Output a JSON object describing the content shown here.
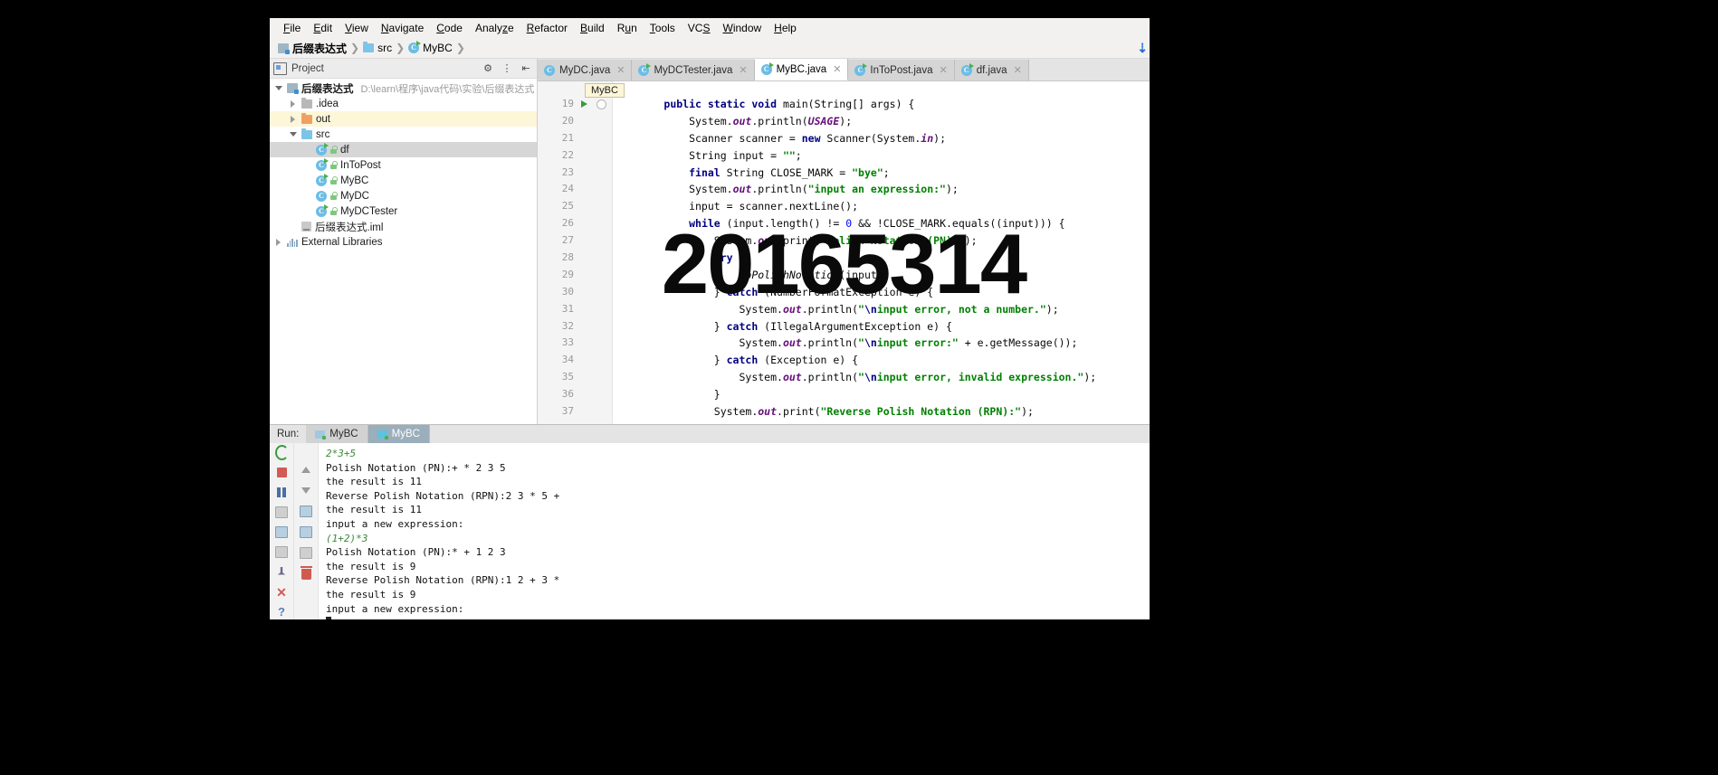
{
  "window": {
    "app": "IntelliJ IDEA",
    "watermark": "20165314"
  },
  "menubar": {
    "items": [
      {
        "label": "File",
        "mnemonic": "F"
      },
      {
        "label": "Edit",
        "mnemonic": "E"
      },
      {
        "label": "View",
        "mnemonic": "V"
      },
      {
        "label": "Navigate",
        "mnemonic": "N"
      },
      {
        "label": "Code",
        "mnemonic": "C"
      },
      {
        "label": "Analyze",
        "mnemonic": "z"
      },
      {
        "label": "Refactor",
        "mnemonic": "R"
      },
      {
        "label": "Build",
        "mnemonic": "B"
      },
      {
        "label": "Run",
        "mnemonic": "u"
      },
      {
        "label": "Tools",
        "mnemonic": "T"
      },
      {
        "label": "VCS",
        "mnemonic": "S"
      },
      {
        "label": "Window",
        "mnemonic": "W"
      },
      {
        "label": "Help",
        "mnemonic": "H"
      }
    ]
  },
  "breadcrumb": {
    "items": [
      "后缀表达式",
      "src",
      "MyBC"
    ],
    "download_icon": "download-icon"
  },
  "project_pane": {
    "title": "Project",
    "tree": [
      {
        "label": "后缀表达式",
        "path": "D:\\learn\\程序\\java代码\\实验\\后缀表达式",
        "indent": 0,
        "icon": "module-icon",
        "state": "open",
        "bold": true
      },
      {
        "label": ".idea",
        "path": "",
        "indent": 1,
        "icon": "folder-gray-icon",
        "state": "closed",
        "bold": false
      },
      {
        "label": "out",
        "path": "",
        "indent": 1,
        "icon": "folder-orange-icon",
        "state": "closed",
        "bold": false,
        "highlight": true
      },
      {
        "label": "src",
        "path": "",
        "indent": 1,
        "icon": "folder-blue-icon",
        "state": "open",
        "bold": false
      },
      {
        "label": "df",
        "path": "",
        "indent": 2,
        "icon": "java-class-runnable-icon",
        "state": "leaf",
        "bold": false,
        "selected": true
      },
      {
        "label": "InToPost",
        "path": "",
        "indent": 2,
        "icon": "java-class-runnable-icon",
        "state": "leaf",
        "bold": false
      },
      {
        "label": "MyBC",
        "path": "",
        "indent": 2,
        "icon": "java-class-runnable-icon",
        "state": "leaf",
        "bold": false
      },
      {
        "label": "MyDC",
        "path": "",
        "indent": 2,
        "icon": "java-class-icon",
        "state": "leaf",
        "bold": false
      },
      {
        "label": "MyDCTester",
        "path": "",
        "indent": 2,
        "icon": "java-class-runnable-icon",
        "state": "leaf",
        "bold": false
      },
      {
        "label": "后缀表达式.iml",
        "path": "",
        "indent": 1,
        "icon": "iml-file-icon",
        "state": "leaf",
        "bold": false
      },
      {
        "label": "External Libraries",
        "path": "",
        "indent": 0,
        "icon": "library-icon",
        "state": "closed",
        "bold": false
      }
    ]
  },
  "editor": {
    "tabs": [
      {
        "label": "MyDC.java",
        "active": false,
        "icon": "java-class-icon"
      },
      {
        "label": "MyDCTester.java",
        "active": false,
        "icon": "java-class-runnable-icon"
      },
      {
        "label": "MyBC.java",
        "active": true,
        "icon": "java-class-runnable-icon"
      },
      {
        "label": "InToPost.java",
        "active": false,
        "icon": "java-class-runnable-icon"
      },
      {
        "label": "df.java",
        "active": false,
        "icon": "java-class-runnable-icon"
      }
    ],
    "breadcrumb_tooltip": "MyBC",
    "lines": [
      {
        "num": "19",
        "gutter": "run-arrow",
        "tokens": [
          {
            "t": "        ",
            "c": "p"
          },
          {
            "t": "public static void ",
            "c": "kw"
          },
          {
            "t": "main(String[] args) {",
            "c": "p"
          }
        ]
      },
      {
        "num": "20",
        "gutter": "",
        "tokens": [
          {
            "t": "            System.",
            "c": "p"
          },
          {
            "t": "out",
            "c": "fld"
          },
          {
            "t": ".println(",
            "c": "p"
          },
          {
            "t": "USAGE",
            "c": "stat"
          },
          {
            "t": ");",
            "c": "p"
          }
        ]
      },
      {
        "num": "21",
        "gutter": "",
        "tokens": [
          {
            "t": "            Scanner scanner = ",
            "c": "p"
          },
          {
            "t": "new",
            "c": "kw"
          },
          {
            "t": " Scanner(System.",
            "c": "p"
          },
          {
            "t": "in",
            "c": "fld"
          },
          {
            "t": ");",
            "c": "p"
          }
        ]
      },
      {
        "num": "22",
        "gutter": "",
        "tokens": [
          {
            "t": "            String input = ",
            "c": "p"
          },
          {
            "t": "\"\"",
            "c": "str"
          },
          {
            "t": ";",
            "c": "p"
          }
        ]
      },
      {
        "num": "23",
        "gutter": "",
        "tokens": [
          {
            "t": "            ",
            "c": "p"
          },
          {
            "t": "final",
            "c": "kw"
          },
          {
            "t": " String CLOSE_MARK = ",
            "c": "p"
          },
          {
            "t": "\"bye\"",
            "c": "str"
          },
          {
            "t": ";",
            "c": "p"
          }
        ]
      },
      {
        "num": "24",
        "gutter": "",
        "tokens": [
          {
            "t": "            System.",
            "c": "p"
          },
          {
            "t": "out",
            "c": "fld"
          },
          {
            "t": ".println(",
            "c": "p"
          },
          {
            "t": "\"input an expression:\"",
            "c": "str"
          },
          {
            "t": ");",
            "c": "p"
          }
        ]
      },
      {
        "num": "25",
        "gutter": "",
        "tokens": [
          {
            "t": "            input = scanner.nextLine();",
            "c": "p"
          }
        ]
      },
      {
        "num": "26",
        "gutter": "",
        "tokens": [
          {
            "t": "            ",
            "c": "p"
          },
          {
            "t": "while",
            "c": "kw"
          },
          {
            "t": " (input.length() != ",
            "c": "p"
          },
          {
            "t": "0",
            "c": "num"
          },
          {
            "t": " && !CLOSE_MARK.equals((input))) {",
            "c": "p"
          }
        ]
      },
      {
        "num": "27",
        "gutter": "",
        "tokens": [
          {
            "t": "                System.",
            "c": "p"
          },
          {
            "t": "out",
            "c": "fld"
          },
          {
            "t": ".print(",
            "c": "p"
          },
          {
            "t": "\"Polish Notation (PN):\"",
            "c": "str"
          },
          {
            "t": ");",
            "c": "p"
          }
        ]
      },
      {
        "num": "28",
        "gutter": "",
        "tokens": [
          {
            "t": "                ",
            "c": "p"
          },
          {
            "t": "try",
            "c": "kw"
          },
          {
            "t": " {",
            "c": "p"
          }
        ]
      },
      {
        "num": "29",
        "gutter": "",
        "tokens": [
          {
            "t": "                    ",
            "c": "p"
          },
          {
            "t": "toPolishNotation",
            "c": "meth"
          },
          {
            "t": "(input);",
            "c": "p"
          }
        ]
      },
      {
        "num": "30",
        "gutter": "",
        "tokens": [
          {
            "t": "                } ",
            "c": "p"
          },
          {
            "t": "catch",
            "c": "kw"
          },
          {
            "t": " (NumberFormatException e) {",
            "c": "p"
          }
        ]
      },
      {
        "num": "31",
        "gutter": "",
        "tokens": [
          {
            "t": "                    System.",
            "c": "p"
          },
          {
            "t": "out",
            "c": "fld"
          },
          {
            "t": ".println(",
            "c": "p"
          },
          {
            "t": "\"",
            "c": "str"
          },
          {
            "t": "\\n",
            "c": "esc"
          },
          {
            "t": "input error, not a number.\"",
            "c": "str"
          },
          {
            "t": ");",
            "c": "p"
          }
        ]
      },
      {
        "num": "32",
        "gutter": "",
        "tokens": [
          {
            "t": "                } ",
            "c": "p"
          },
          {
            "t": "catch",
            "c": "kw"
          },
          {
            "t": " (IllegalArgumentException e) {",
            "c": "p"
          }
        ]
      },
      {
        "num": "33",
        "gutter": "",
        "tokens": [
          {
            "t": "                    System.",
            "c": "p"
          },
          {
            "t": "out",
            "c": "fld"
          },
          {
            "t": ".println(",
            "c": "p"
          },
          {
            "t": "\"",
            "c": "str"
          },
          {
            "t": "\\n",
            "c": "esc"
          },
          {
            "t": "input error:\"",
            "c": "str"
          },
          {
            "t": " + e.getMessage());",
            "c": "p"
          }
        ]
      },
      {
        "num": "34",
        "gutter": "",
        "tokens": [
          {
            "t": "                } ",
            "c": "p"
          },
          {
            "t": "catch",
            "c": "kw"
          },
          {
            "t": " (Exception e) {",
            "c": "p"
          }
        ]
      },
      {
        "num": "35",
        "gutter": "",
        "tokens": [
          {
            "t": "                    System.",
            "c": "p"
          },
          {
            "t": "out",
            "c": "fld"
          },
          {
            "t": ".println(",
            "c": "p"
          },
          {
            "t": "\"",
            "c": "str"
          },
          {
            "t": "\\n",
            "c": "esc"
          },
          {
            "t": "input error, invalid expression.\"",
            "c": "str"
          },
          {
            "t": ");",
            "c": "p"
          }
        ]
      },
      {
        "num": "36",
        "gutter": "",
        "tokens": [
          {
            "t": "                }",
            "c": "p"
          }
        ]
      },
      {
        "num": "37",
        "gutter": "",
        "tokens": [
          {
            "t": "                System.",
            "c": "p"
          },
          {
            "t": "out",
            "c": "fld"
          },
          {
            "t": ".print(",
            "c": "p"
          },
          {
            "t": "\"Reverse Polish Notation (RPN):\"",
            "c": "str"
          },
          {
            "t": ");",
            "c": "p"
          }
        ]
      }
    ]
  },
  "run_panel": {
    "label": "Run:",
    "tabs": [
      {
        "label": "MyBC",
        "active": false
      },
      {
        "label": "MyBC",
        "active": true
      }
    ],
    "toolbar_left": [
      {
        "name": "rerun-button"
      },
      {
        "name": "stop-button"
      },
      {
        "name": "pause-button"
      },
      {
        "name": "dump-threads-button"
      },
      {
        "name": "trace-button"
      },
      {
        "name": "print-button"
      },
      {
        "name": "pin-button"
      },
      {
        "name": "close-button"
      },
      {
        "name": "help-button"
      }
    ],
    "toolbar_right": [
      {
        "name": "scroll-up-button"
      },
      {
        "name": "scroll-down-button"
      },
      {
        "name": "soft-wrap-button"
      },
      {
        "name": "scroll-to-end-button"
      },
      {
        "name": "print-output-button"
      },
      {
        "name": "clear-all-button"
      }
    ],
    "console": [
      {
        "text": "2*3+5",
        "kind": "input"
      },
      {
        "text": "Polish Notation (PN):+ * 2 3 5",
        "kind": "output"
      },
      {
        "text": "the result is 11",
        "kind": "output"
      },
      {
        "text": "Reverse Polish Notation (RPN):2 3 * 5 +",
        "kind": "output"
      },
      {
        "text": "the result is 11",
        "kind": "output"
      },
      {
        "text": "input a new expression:",
        "kind": "output"
      },
      {
        "text": "(1+2)*3",
        "kind": "input"
      },
      {
        "text": "Polish Notation (PN):* + 1 2 3",
        "kind": "output"
      },
      {
        "text": "the result is 9",
        "kind": "output"
      },
      {
        "text": "Reverse Polish Notation (RPN):1 2 + 3 *",
        "kind": "output"
      },
      {
        "text": "the result is 9",
        "kind": "output"
      },
      {
        "text": "input a new expression:",
        "kind": "output"
      },
      {
        "text": "",
        "kind": "caret"
      }
    ]
  },
  "colors": {
    "keyword": "#000080",
    "string": "#008000",
    "field": "#660e7a",
    "number": "#0000ff",
    "selection": "#d6d6d6",
    "run_tab_active": "#9aaebb"
  }
}
